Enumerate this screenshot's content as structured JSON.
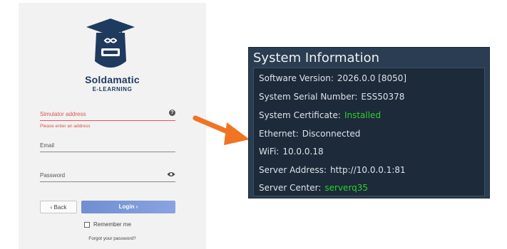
{
  "login": {
    "brand_name": "Soldamatic",
    "brand_sub": "E-LEARNING",
    "simulator_label": "Simulator address",
    "simulator_error": "Please enter an address",
    "email_label": "Email",
    "password_label": "Password",
    "back_label": "Back",
    "login_label": "Login",
    "remember_label": "Remember me",
    "forgot_label": "Forgot your password?"
  },
  "arrow_color": "#f07422",
  "sysinfo": {
    "title": "System Information",
    "rows": [
      {
        "label": "Software Version:",
        "value": "2026.0.0 [8050]"
      },
      {
        "label": "System Serial Number:",
        "value": "ESS50378"
      },
      {
        "label": "System Certificate:",
        "value": "Installed",
        "highlight": true
      },
      {
        "label": "Ethernet:",
        "value": "Disconnected"
      },
      {
        "label": "WiFi:",
        "value": "10.0.0.18"
      },
      {
        "label": "Server Address:",
        "value": "http://10.0.0.1:81"
      },
      {
        "label": "Server Center:",
        "value": "serverq35",
        "highlight": true
      }
    ]
  }
}
